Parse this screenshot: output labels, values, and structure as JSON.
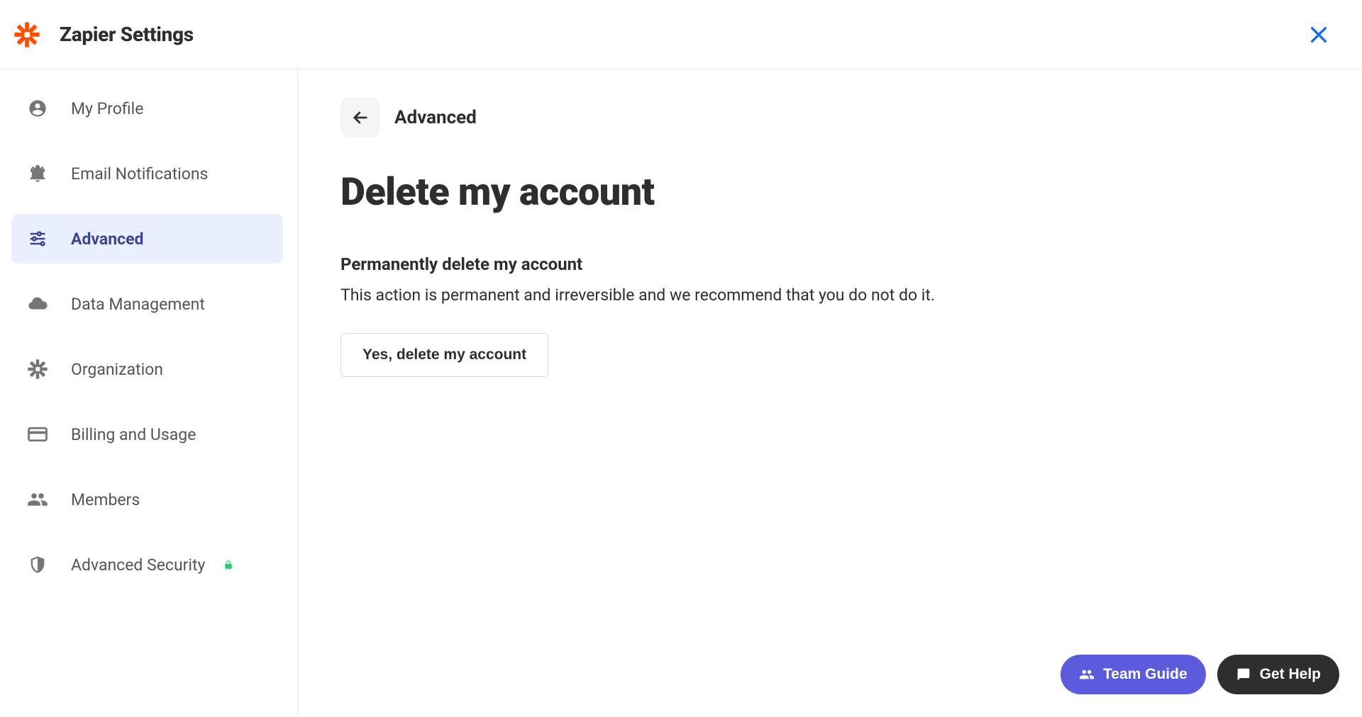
{
  "header": {
    "title": "Zapier Settings"
  },
  "sidebar": {
    "items": [
      {
        "label": "My Profile"
      },
      {
        "label": "Email Notifications"
      },
      {
        "label": "Advanced"
      },
      {
        "label": "Data Management"
      },
      {
        "label": "Organization"
      },
      {
        "label": "Billing and Usage"
      },
      {
        "label": "Members"
      },
      {
        "label": "Advanced Security"
      }
    ]
  },
  "main": {
    "breadcrumb": "Advanced",
    "page_title": "Delete my account",
    "section_heading": "Permanently delete my account",
    "section_desc": "This action is permanent and irreversible and we recommend that you do not do it.",
    "delete_button": "Yes, delete my account"
  },
  "floating": {
    "team_guide": "Team Guide",
    "get_help": "Get Help"
  }
}
